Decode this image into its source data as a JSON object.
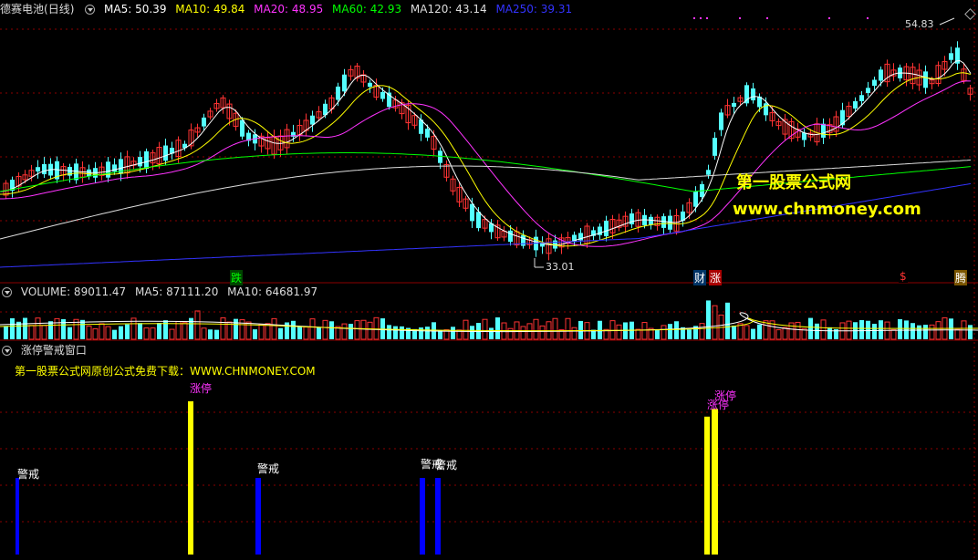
{
  "main_header": {
    "stock": "德赛电池",
    "period": "(日线)",
    "ma": [
      {
        "label": "MA5: 50.39",
        "color": "#ffffff"
      },
      {
        "label": "MA10: 49.84",
        "color": "#ffff00"
      },
      {
        "label": "MA20: 48.95",
        "color": "#ff33ff"
      },
      {
        "label": "MA60: 42.93",
        "color": "#00ff00"
      },
      {
        "label": "MA120: 43.14",
        "color": "#dddddd"
      },
      {
        "label": "MA250: 39.31",
        "color": "#3333ff"
      }
    ]
  },
  "price_marks": {
    "high": "54.83",
    "low": "33.01"
  },
  "event_tags": [
    {
      "text": "跌",
      "color": "#00ff00",
      "bg": "#004400"
    },
    {
      "text": "财",
      "color": "#ffffff",
      "bg": "#003366"
    },
    {
      "text": "涨",
      "color": "#ffffff",
      "bg": "#aa0000"
    },
    {
      "text": "$",
      "color": "#ff3333",
      "bg": "#000000"
    },
    {
      "text": "腾",
      "color": "#ffffff",
      "bg": "#7a5500"
    }
  ],
  "volume_header": {
    "label": "VOLUME: 89011.47",
    "ma5": "MA5: 87111.20",
    "ma10": "MA10: 64681.97"
  },
  "window_header": {
    "title": "涨停警戒窗口"
  },
  "promo": "第一股票公式网原创公式免费下载：WWW.CHNMONEY.COM",
  "watermark": {
    "line1": "第一股票公式网",
    "line2": "www.chnmoney.com"
  },
  "signals": [
    {
      "text": "警戒",
      "color": "#ffffff",
      "bar_color": "#0000ff",
      "level": 0.5
    },
    {
      "text": "涨停",
      "color": "#ff33ff",
      "bar_color": "#ffff00",
      "level": 1.0
    },
    {
      "text": "警戒",
      "color": "#ffffff",
      "bar_color": "#0000ff",
      "level": 0.5
    },
    {
      "text": "警戒",
      "color": "#ffffff",
      "bar_color": "#0000ff",
      "level": 0.5
    },
    {
      "text": "警戒",
      "color": "#ffffff",
      "bar_color": "#0000ff",
      "level": 0.5
    },
    {
      "text": "涨停",
      "color": "#ff33ff",
      "bar_color": "#ffff00",
      "level": 0.9
    },
    {
      "text": "涨停",
      "color": "#ff33ff",
      "bar_color": "#ffff00",
      "level": 0.95
    }
  ],
  "colors": {
    "up": "#ff3333",
    "down": "#54ffff",
    "grid": "#8b0000"
  }
}
